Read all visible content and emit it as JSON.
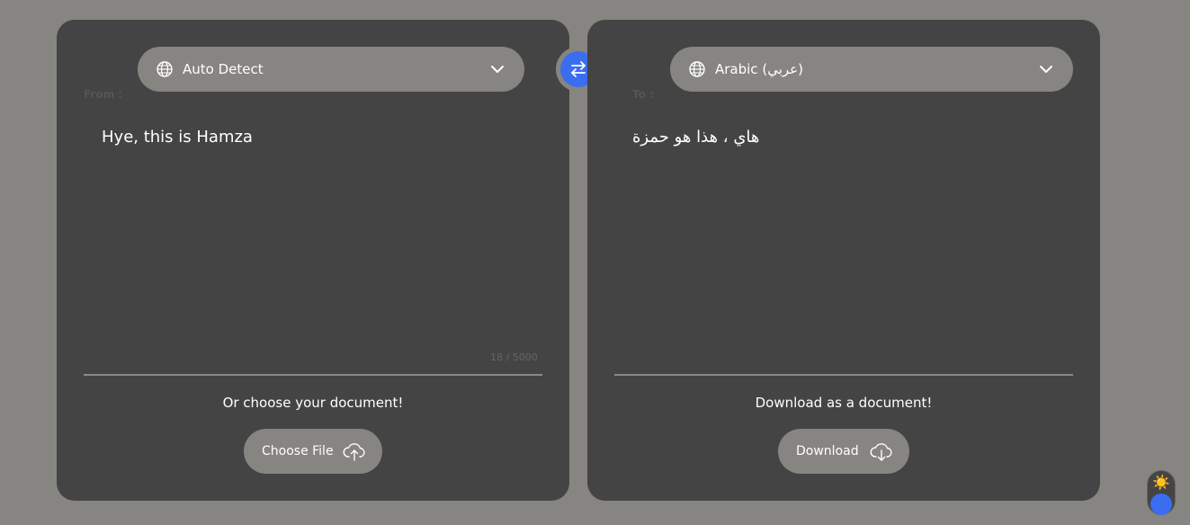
{
  "source": {
    "label": "From :",
    "language": "Auto Detect",
    "text": "Hye, this is Hamza",
    "counter": "18 / 5000",
    "doc_caption": "Or choose your document!",
    "file_button": "Choose File"
  },
  "target": {
    "label": "To :",
    "language": "Arabic (عربي)",
    "text": "هاي ، هذا هو حمزة",
    "doc_caption": "Download as a document!",
    "download_button": "Download"
  },
  "theme_toggle": {
    "icon": "☀️",
    "mode": "dark"
  },
  "colors": {
    "background": "#878581",
    "panel": "#444444",
    "accent": "#3a6df0"
  }
}
